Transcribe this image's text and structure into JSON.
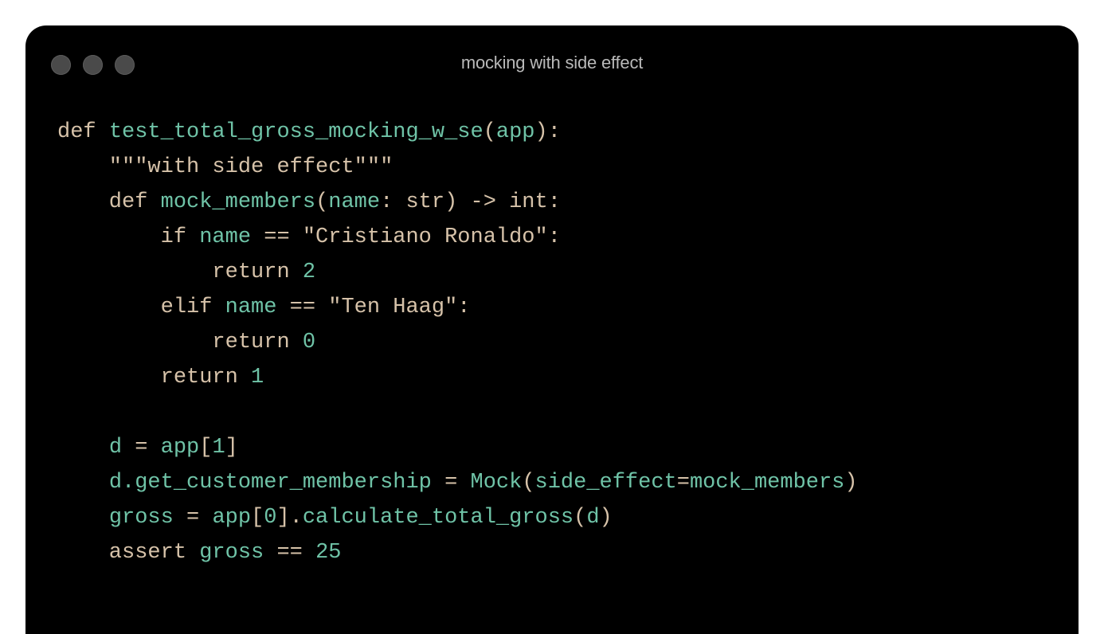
{
  "window": {
    "title": "mocking with side effect"
  },
  "code": {
    "lines": [
      [
        {
          "text": "def ",
          "kind": "kw"
        },
        {
          "text": "test_total_gross_mocking_w_se",
          "kind": "fn"
        },
        {
          "text": "(",
          "kind": "plain"
        },
        {
          "text": "app",
          "kind": "var"
        },
        {
          "text": "):",
          "kind": "plain"
        }
      ],
      [
        {
          "text": "    \"\"\"with side effect\"\"\"",
          "kind": "str"
        }
      ],
      [
        {
          "text": "    def ",
          "kind": "kw"
        },
        {
          "text": "mock_members",
          "kind": "fn"
        },
        {
          "text": "(",
          "kind": "plain"
        },
        {
          "text": "name",
          "kind": "var"
        },
        {
          "text": ": str) -> int:",
          "kind": "plain"
        }
      ],
      [
        {
          "text": "        if ",
          "kind": "kw"
        },
        {
          "text": "name",
          "kind": "var"
        },
        {
          "text": " == \"Cristiano Ronaldo\":",
          "kind": "plain"
        }
      ],
      [
        {
          "text": "            return ",
          "kind": "kw"
        },
        {
          "text": "2",
          "kind": "num"
        }
      ],
      [
        {
          "text": "        elif ",
          "kind": "kw"
        },
        {
          "text": "name",
          "kind": "var"
        },
        {
          "text": " == \"Ten Haag\":",
          "kind": "plain"
        }
      ],
      [
        {
          "text": "            return ",
          "kind": "kw"
        },
        {
          "text": "0",
          "kind": "num"
        }
      ],
      [
        {
          "text": "        return ",
          "kind": "kw"
        },
        {
          "text": "1",
          "kind": "num"
        }
      ],
      [
        {
          "text": "",
          "kind": "plain"
        }
      ],
      [
        {
          "text": "    ",
          "kind": "plain"
        },
        {
          "text": "d",
          "kind": "var"
        },
        {
          "text": " = ",
          "kind": "plain"
        },
        {
          "text": "app",
          "kind": "var"
        },
        {
          "text": "[",
          "kind": "plain"
        },
        {
          "text": "1",
          "kind": "num"
        },
        {
          "text": "]",
          "kind": "plain"
        }
      ],
      [
        {
          "text": "    ",
          "kind": "plain"
        },
        {
          "text": "d.get_customer_membership",
          "kind": "var"
        },
        {
          "text": " = ",
          "kind": "plain"
        },
        {
          "text": "Mock",
          "kind": "fn"
        },
        {
          "text": "(",
          "kind": "plain"
        },
        {
          "text": "side_effect",
          "kind": "var"
        },
        {
          "text": "=",
          "kind": "plain"
        },
        {
          "text": "mock_members",
          "kind": "var"
        },
        {
          "text": ")",
          "kind": "plain"
        }
      ],
      [
        {
          "text": "    ",
          "kind": "plain"
        },
        {
          "text": "gross",
          "kind": "var"
        },
        {
          "text": " = ",
          "kind": "plain"
        },
        {
          "text": "app",
          "kind": "var"
        },
        {
          "text": "[",
          "kind": "plain"
        },
        {
          "text": "0",
          "kind": "num"
        },
        {
          "text": "].",
          "kind": "plain"
        },
        {
          "text": "calculate_total_gross",
          "kind": "fn"
        },
        {
          "text": "(",
          "kind": "plain"
        },
        {
          "text": "d",
          "kind": "var"
        },
        {
          "text": ")",
          "kind": "plain"
        }
      ],
      [
        {
          "text": "    assert ",
          "kind": "kw"
        },
        {
          "text": "gross",
          "kind": "var"
        },
        {
          "text": " == ",
          "kind": "plain"
        },
        {
          "text": "25",
          "kind": "num"
        }
      ]
    ]
  },
  "colors": {
    "background": "#000000",
    "keyword": "#d6c2a9",
    "identifier": "#6fc3a7",
    "window_dot": "#4a4a4a",
    "title_text": "#b9b9b9"
  },
  "icons": {
    "window_controls": [
      "close-dot-icon",
      "minimize-dot-icon",
      "maximize-dot-icon"
    ]
  }
}
